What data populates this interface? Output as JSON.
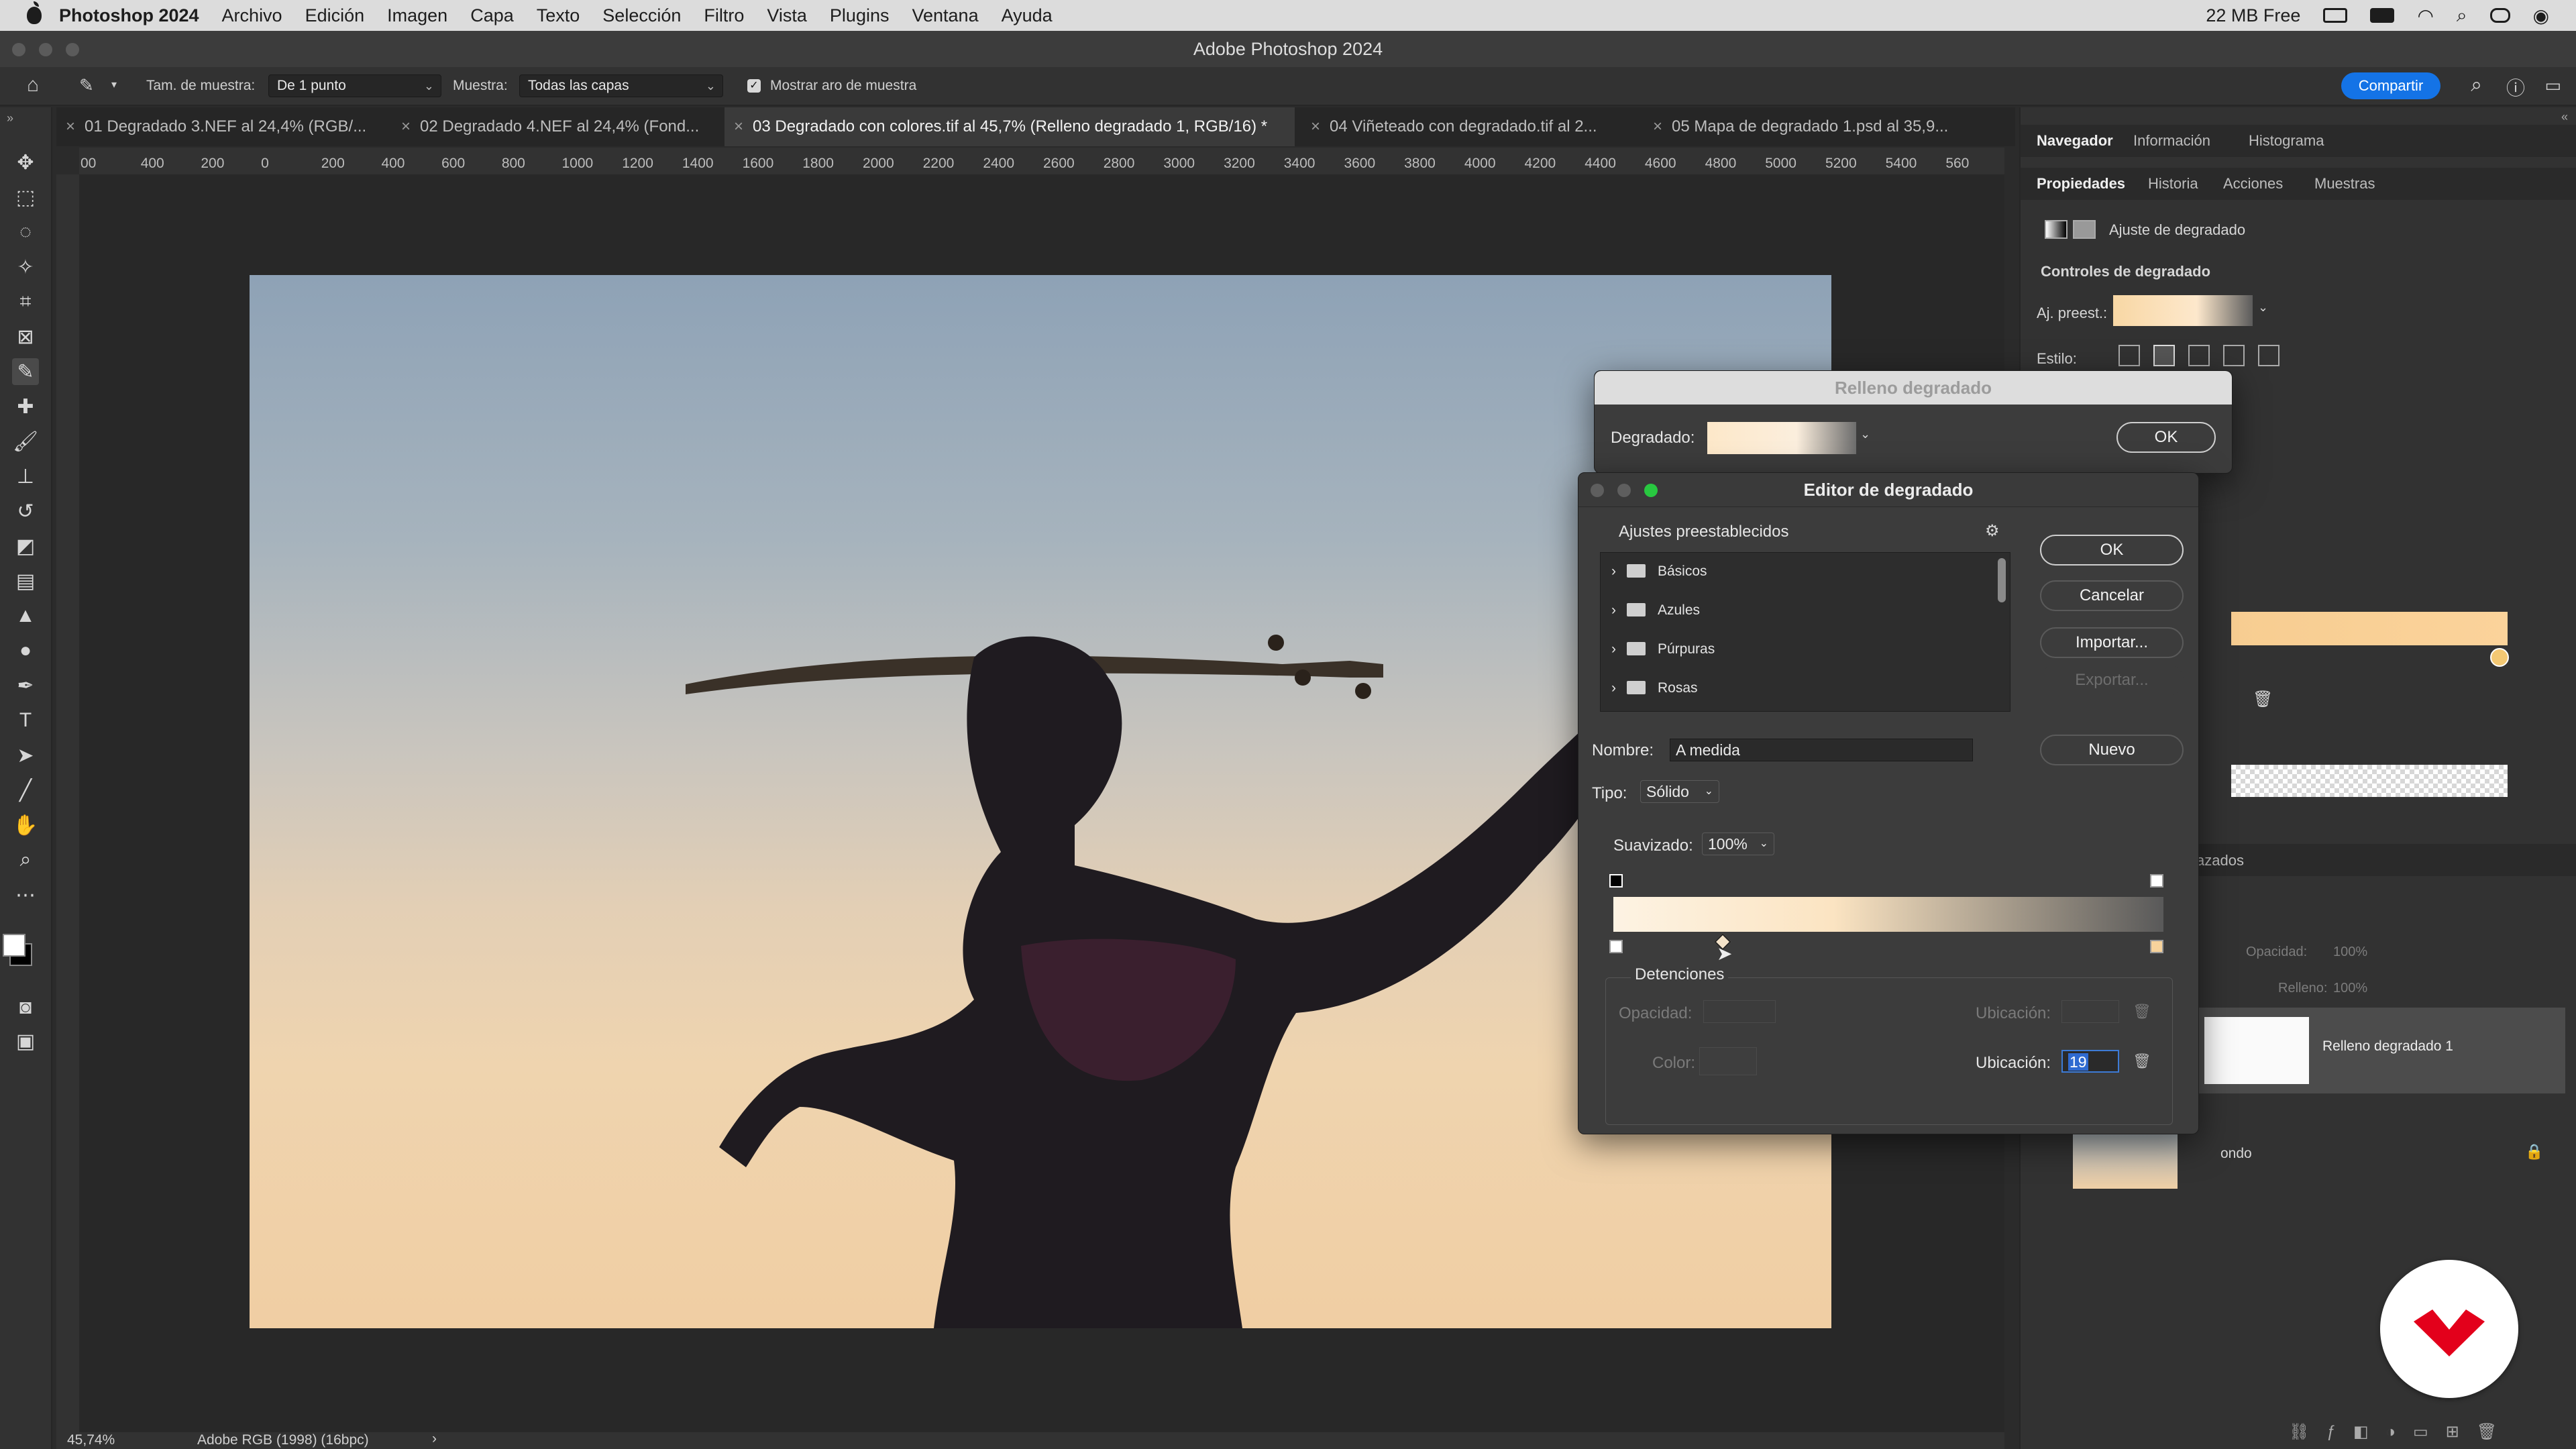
{
  "menubar": {
    "app": "Photoshop 2024",
    "items": [
      "Archivo",
      "Edición",
      "Imagen",
      "Capa",
      "Texto",
      "Selección",
      "Filtro",
      "Vista",
      "Plugins",
      "Ventana",
      "Ayuda"
    ],
    "free_mem": "22 MB Free"
  },
  "window": {
    "title": "Adobe Photoshop 2024"
  },
  "options": {
    "sample_size_label": "Tam. de muestra:",
    "sample_size_value": "De 1 punto",
    "sample_label": "Muestra:",
    "sample_value": "Todas las capas",
    "ring_label": "Mostrar aro de muestra",
    "share_label": "Compartir"
  },
  "tabs": [
    "01 Degradado 3.NEF al 24,4% (RGB/...",
    "02 Degradado 4.NEF al 24,4% (Fond...",
    "03 Degradado con colores.tif al 45,7% (Relleno degradado 1, RGB/16) *",
    "04 Viñeteado con degradado.tif al 2...",
    "05 Mapa de degradado 1.psd al 35,9..."
  ],
  "ruler_labels": [
    "00",
    "400",
    "200",
    "0",
    "200",
    "400",
    "600",
    "800",
    "1000",
    "1200",
    "1400",
    "1600",
    "1800",
    "2000",
    "2200",
    "2400",
    "2600",
    "2800",
    "3000",
    "3200",
    "3400",
    "3600",
    "3800",
    "4000",
    "4200",
    "4400",
    "4600",
    "4800",
    "5000",
    "5200",
    "5400",
    "560"
  ],
  "status": {
    "zoom": "45,74%",
    "profile": "Adobe RGB (1998) (16bpc)"
  },
  "panels": {
    "top_tabs": [
      "Navegador",
      "Información",
      "Histograma"
    ],
    "second_tabs": [
      "Propiedades",
      "Historia",
      "Acciones",
      "Muestras"
    ],
    "adjust_title": "Ajuste de degradado",
    "controls_title": "Controles de degradado",
    "preset_label": "Aj. preest.:",
    "style_label": "Estilo:",
    "layers_tab_fragment": "azados",
    "layer_opacity_label": "Opacidad:",
    "layer_opacity_value": "100%",
    "layer_fill_label": "Relleno:",
    "layer_fill_value": "100%",
    "layer1_name": "Relleno degradado 1",
    "layer2_name": "ondo"
  },
  "relleno_dialog": {
    "title": "Relleno degradado",
    "gradient_label": "Degradado:",
    "ok_label": "OK"
  },
  "editor": {
    "title": "Editor de degradado",
    "presets_title": "Ajustes preestablecidos",
    "preset_folders": [
      "Básicos",
      "Azules",
      "Púrpuras",
      "Rosas"
    ],
    "buttons": {
      "ok": "OK",
      "cancel": "Cancelar",
      "import": "Importar...",
      "export": "Exportar...",
      "new": "Nuevo"
    },
    "name_label": "Nombre:",
    "name_value": "A medida",
    "type_label": "Tipo:",
    "type_value": "Sólido",
    "smooth_label": "Suavizado:",
    "smooth_value": "100%",
    "stops_title": "Detenciones",
    "opacity_label": "Opacidad:",
    "location_label": "Ubicación:",
    "color_label": "Color:",
    "location_value": "19"
  },
  "colors": {
    "accent": "#1473e6",
    "gradient_start": "#fdf3e3",
    "gradient_end": "#f7d39c",
    "brand_logo": "#e3001b"
  }
}
